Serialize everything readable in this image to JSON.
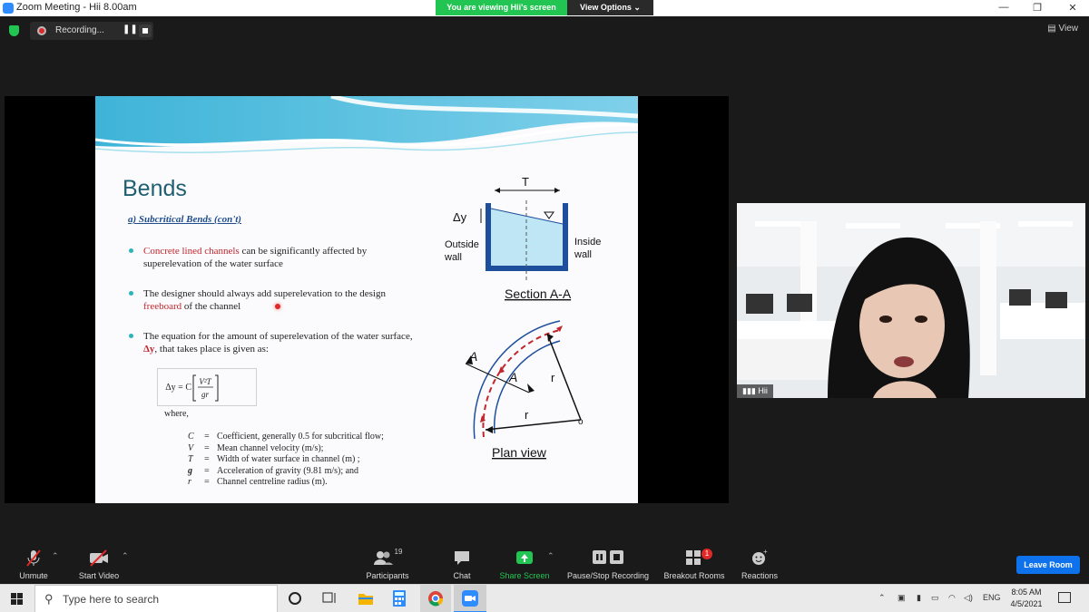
{
  "window": {
    "title": "Zoom Meeting - Hii 8.00am",
    "viewing_banner": "You are viewing Hii's screen",
    "view_options": "View Options",
    "minimize": "—",
    "restore": "❐",
    "close": "✕"
  },
  "top_strip": {
    "recording_label": "Recording...",
    "pause": "❚❚",
    "view_label": "View"
  },
  "slide": {
    "title": "Bends",
    "subtitle": "a) Subcritical Bends (con't)",
    "bullet1_red": "Concrete lined channels",
    "bullet1_text": " can be significantly affected by superelevation of the water surface",
    "bullet2_text": "The designer should always add superelevation to the design ",
    "bullet2_red": "freeboard",
    "bullet2_tail": " of the channel",
    "bullet3_text": "The equation for the amount of superelevation of the water surface, ",
    "bullet3_red": "Δy",
    "bullet3_tail": ", that takes place is given as:",
    "equation_lhs": "Δy = C",
    "equation_num": "V²T",
    "equation_den": "gr",
    "where": "where,",
    "variables": [
      {
        "sym": "C",
        "eq": "=",
        "desc": "Coefficient, generally 0.5 for subcritical flow;"
      },
      {
        "sym": "V",
        "eq": "=",
        "desc": "Mean channel velocity (m/s);"
      },
      {
        "sym": "T",
        "eq": "=",
        "desc": "Width of water surface in channel (m) ;"
      },
      {
        "sym": "g",
        "eq": "=",
        "desc": "Acceleration of gravity (9.81 m/s); and"
      },
      {
        "sym": "r",
        "eq": "=",
        "desc": "Channel centreline radius (m)."
      }
    ],
    "diagram": {
      "t_label": "T",
      "dy_label": "Δy",
      "outside_label_1": "Outside",
      "outside_label_2": "wall",
      "inside_label_1": "Inside",
      "inside_label_2": "wall",
      "section_caption": "Section A-A",
      "a_label": "A",
      "r_label": "r",
      "o_label": "o",
      "plan_caption": "Plan view"
    }
  },
  "participant": {
    "name": "Hii"
  },
  "toolbar": {
    "unmute": "Unmute",
    "start_video": "Start Video",
    "participants": "Participants",
    "participants_count": "19",
    "chat": "Chat",
    "share_screen": "Share Screen",
    "pause_stop_recording": "Pause/Stop Recording",
    "breakout_rooms": "Breakout Rooms",
    "breakout_badge": "1",
    "reactions": "Reactions",
    "leave_room": "Leave Room"
  },
  "taskbar": {
    "search_placeholder": "Type here to search",
    "language": "ENG",
    "time": "8:05 AM",
    "date": "4/5/2021"
  },
  "colors": {
    "zoom_blue": "#2d8cff",
    "share_green": "#23c552",
    "leave_blue": "#0e72ed",
    "slide_title_teal": "#1f5f72",
    "slide_red": "#c0272d"
  }
}
